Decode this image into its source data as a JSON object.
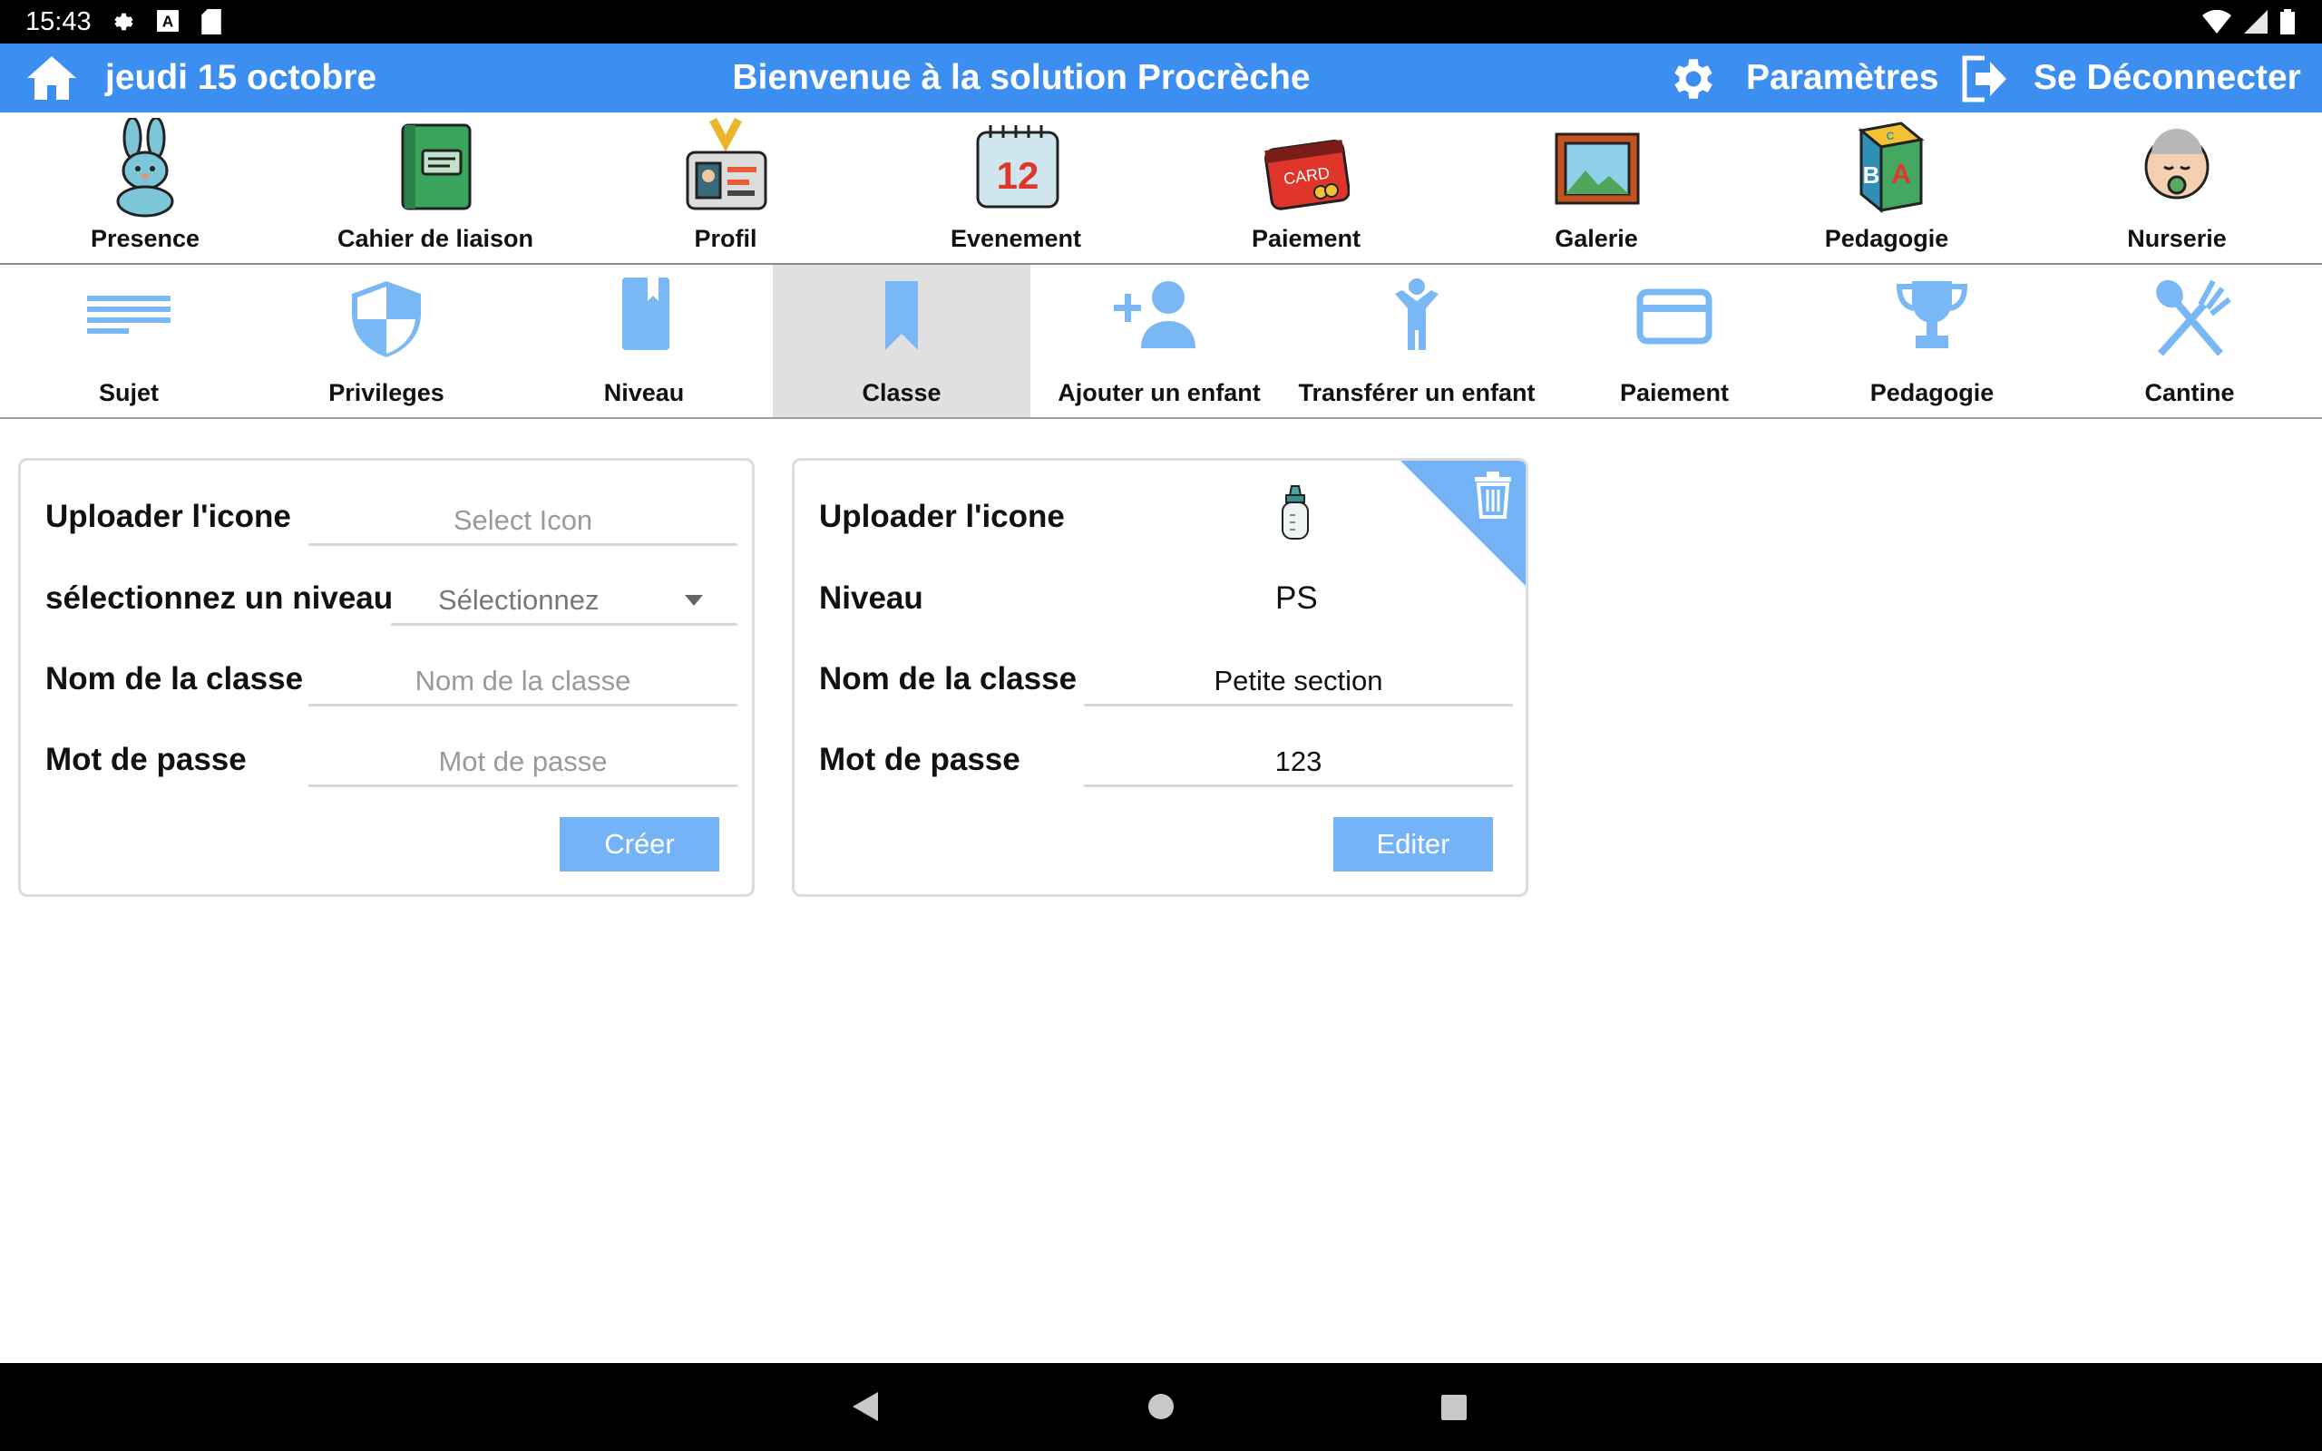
{
  "status": {
    "time": "15:43"
  },
  "header": {
    "date": "jeudi 15 octobre",
    "title": "Bienvenue à la solution Procrèche",
    "settings_label": "Paramètres",
    "logout_label": "Se Déconnecter",
    "color": "#3c8ef0"
  },
  "topnav": [
    {
      "label": "Presence",
      "icon": "bunny-icon"
    },
    {
      "label": "Cahier de liaison",
      "icon": "notebook-icon"
    },
    {
      "label": "Profil",
      "icon": "id-badge-icon"
    },
    {
      "label": "Evenement",
      "icon": "calendar-icon",
      "number": "12"
    },
    {
      "label": "Paiement",
      "icon": "credit-card-icon",
      "card_text": "CARD"
    },
    {
      "label": "Galerie",
      "icon": "picture-frame-icon"
    },
    {
      "label": "Pedagogie",
      "icon": "abc-blocks-icon",
      "letters": [
        "B",
        "A",
        "C"
      ]
    },
    {
      "label": "Nurserie",
      "icon": "baby-icon"
    }
  ],
  "setnav": [
    {
      "label": "Sujet",
      "icon": "lines-icon"
    },
    {
      "label": "Privileges",
      "icon": "shield-icon"
    },
    {
      "label": "Niveau",
      "icon": "book-icon"
    },
    {
      "label": "Classe",
      "icon": "bookmark-icon",
      "active": true
    },
    {
      "label": "Ajouter un enfant",
      "icon": "add-person-icon"
    },
    {
      "label": "Transférer un enfant",
      "icon": "child-icon"
    },
    {
      "label": "Paiement",
      "icon": "card-icon"
    },
    {
      "label": "Pedagogie",
      "icon": "trophy-icon"
    },
    {
      "label": "Cantine",
      "icon": "utensils-icon"
    }
  ],
  "create_form": {
    "upload_label": "Uploader l'icone",
    "upload_placeholder": "Select Icon",
    "level_label": "sélectionnez un niveau",
    "level_placeholder": "Sélectionnez",
    "name_label": "Nom de la classe",
    "name_placeholder": "Nom de la classe",
    "password_label": "Mot de passe",
    "password_placeholder": "Mot de passe",
    "submit_label": "Créer"
  },
  "class_card": {
    "upload_label": "Uploader l'icone",
    "icon": "baby-bottle-icon",
    "level_label": "Niveau",
    "level_value": "PS",
    "name_label": "Nom de la classe",
    "name_value": "Petite section",
    "password_label": "Mot de passe",
    "password_value": "123",
    "edit_label": "Editer"
  },
  "colors": {
    "accent": "#3c8ef0",
    "button": "#74b4f6",
    "icon_blue": "#7ab8f5"
  }
}
